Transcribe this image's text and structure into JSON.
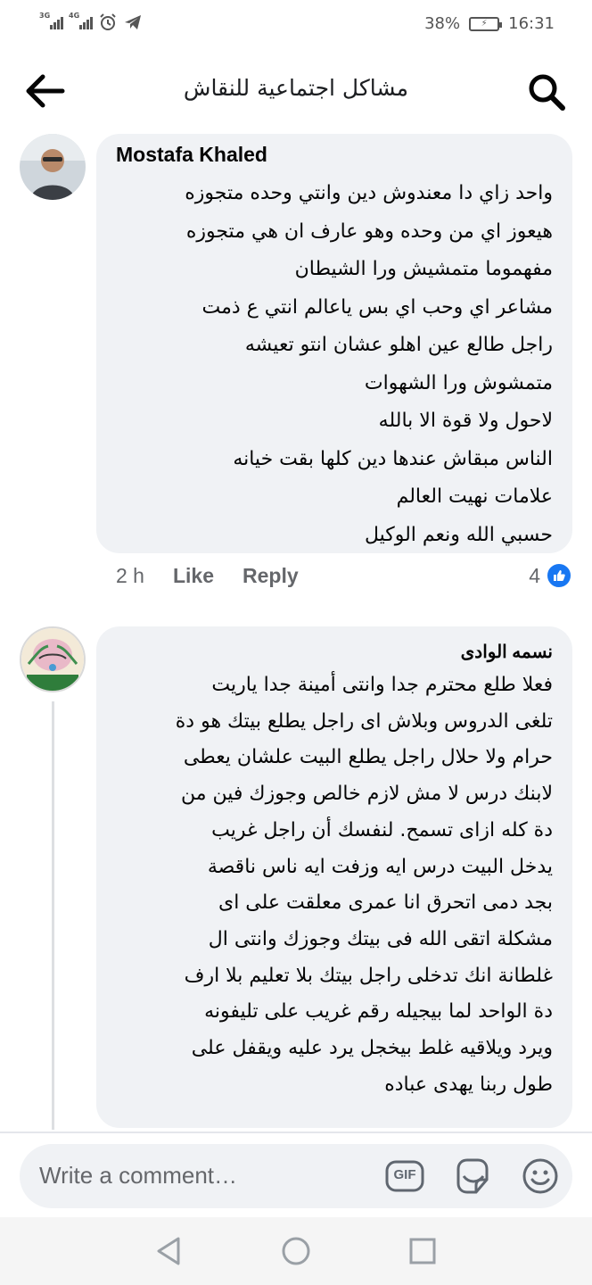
{
  "status_bar": {
    "signal_1": "3G",
    "signal_2": "4G",
    "battery_percent": "38%",
    "time": "16:31"
  },
  "header": {
    "title": "مشاكل اجتماعية للنقاش",
    "back_icon": "arrow-left-icon",
    "search_icon": "search-icon"
  },
  "comments": [
    {
      "author": "Mostafa Khaled",
      "lines": [
        "واحد زاي دا معندوش دين وانتي وحده متجوزه",
        "هيعوز اي من وحده وهو عارف ان هي متجوزه",
        "مفهموما متمشيش ورا الشيطان",
        "مشاعر اي وحب اي بس ياعالم انتي ع ذمت",
        "راجل طالع عين اهلو عشان انتو تعيشه",
        "متمشوش ورا الشهوات",
        "لاحول ولا قوة الا بالله",
        "الناس مبقاش عندها دين كلها بقت خيانه",
        "علامات نهيت العالم",
        "حسبي الله ونعم الوكيل"
      ],
      "time": "2 h",
      "like_label": "Like",
      "reply_label": "Reply",
      "reaction_count": "4"
    },
    {
      "author": "نسمه الوادى",
      "lines": [
        "فعلا طلع محترم جدا وانتى أمينة جدا ياريت",
        "تلغى الدروس وبلاش اى راجل يطلع بيتك هو دة",
        "حرام ولا حلال راجل يطلع البيت علشان يعطى",
        "لابنك درس لا مش لازم خالص وجوزك فين من",
        "دة كله ازاى تسمح. لنفسك أن راجل غريب",
        "يدخل البيت درس ايه وزفت ايه ناس ناقصة",
        "بجد دمى اتحرق انا عمرى معلقت على اى",
        "مشكلة اتقى الله فى بيتك وجوزك وانتى ال",
        "غلطانة انك تدخلى راجل بيتك بلا تعليم بلا ارف",
        "دة الواحد لما بيجيله رقم غريب على تليفونه",
        "ويرد ويلاقيه غلط بيخجل يرد عليه ويقفل على",
        "طول ربنا يهدى عباده"
      ]
    }
  ],
  "composer": {
    "placeholder": "Write a comment…",
    "gif_label": "GIF",
    "sticker_icon": "sticker-icon",
    "emoji_icon": "emoji-icon"
  },
  "nav": {
    "back_icon": "triangle-back-icon",
    "home_icon": "circle-home-icon",
    "recents_icon": "square-recents-icon"
  },
  "colors": {
    "bubble": "#f0f2f5",
    "like_blue": "#1877f2",
    "secondary_text": "#65676b"
  }
}
